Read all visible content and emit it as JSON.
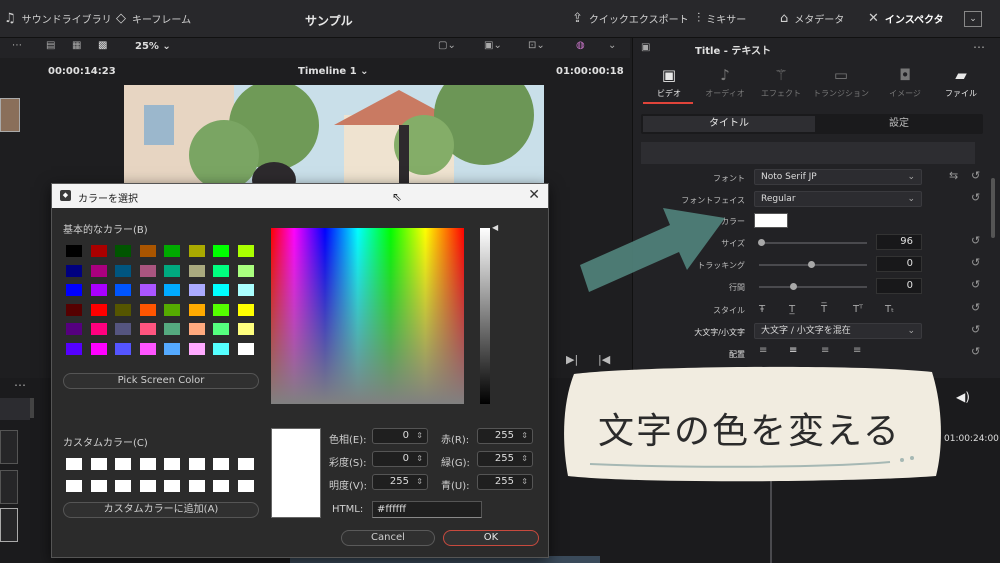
{
  "topbar": {
    "sound_library": "サウンドライブラリ",
    "keyframes": "キーフレーム",
    "title": "サンプル",
    "quick_export": "クイックエクスポート",
    "mixer": "ミキサー",
    "metadata": "メタデータ",
    "inspector": "インスペクタ"
  },
  "viewer": {
    "zoom": "25%",
    "timecode_left": "00:00:14:23",
    "timeline_name": "Timeline 1",
    "timecode_right": "01:00:00:18",
    "timeline_tc": "01:00:24:00"
  },
  "inspector": {
    "title": "Title - テキスト",
    "tabs": [
      "ビデオ",
      "オーディオ",
      "エフェクト",
      "トランジション",
      "イメージ",
      "ファイル"
    ],
    "subtabs": [
      "タイトル",
      "設定"
    ],
    "font_label": "フォント",
    "font_value": "Noto Serif JP",
    "face_label": "フォントフェイス",
    "face_value": "Regular",
    "color_label": "カラー",
    "color_value": "#ffffff",
    "size_label": "サイズ",
    "size_value": "96",
    "size_fraction": 0.02,
    "tracking_label": "トラッキング",
    "tracking_value": "0",
    "tracking_fraction": 0.5,
    "line_label": "行間",
    "line_value": "0",
    "line_fraction": 0.33,
    "style_label": "スタイル",
    "case_label": "大文字/小文字",
    "case_value": "大文字 / 小文字を混在",
    "align_label": "配置"
  },
  "callout": {
    "text": "文字の色を変える",
    "bg_color": "#f1ece0"
  },
  "dialog": {
    "title": "カラーを選択",
    "basic_colors_label": "基本的なカラー(B)",
    "basic_colors": [
      "#000000",
      "#aa0000",
      "#005500",
      "#aa5500",
      "#00aa00",
      "#aaaa00",
      "#00ff00",
      "#aaff00",
      "#00007f",
      "#aa007f",
      "#00557f",
      "#aa557f",
      "#00aa7f",
      "#aaaa7f",
      "#00ff7f",
      "#aaff7f",
      "#0000ff",
      "#aa00ff",
      "#0055ff",
      "#aa55ff",
      "#00aaff",
      "#aaaaff",
      "#00ffff",
      "#aaffff",
      "#550000",
      "#ff0000",
      "#555500",
      "#ff5500",
      "#55aa00",
      "#ffaa00",
      "#55ff00",
      "#ffff00",
      "#55007f",
      "#ff007f",
      "#55557f",
      "#ff557f",
      "#55aa7f",
      "#ffaa7f",
      "#55ff7f",
      "#ffff7f",
      "#5500ff",
      "#ff00ff",
      "#5555ff",
      "#ff55ff",
      "#55aaff",
      "#ffaaff",
      "#55ffff",
      "#ffffff"
    ],
    "pick_screen": "Pick Screen Color",
    "custom_colors_label": "カスタムカラー(C)",
    "add_custom": "カスタムカラーに追加(A)",
    "hue_label": "色相(E):",
    "hue": "0",
    "sat_label": "彩度(S):",
    "sat": "0",
    "val_label": "明度(V):",
    "val": "255",
    "red_label": "赤(R):",
    "red": "255",
    "green_label": "緑(G):",
    "green": "255",
    "blue_label": "青(U):",
    "blue": "255",
    "html_label": "HTML:",
    "html_value": "#ffffff",
    "cancel": "Cancel",
    "ok": "OK"
  }
}
